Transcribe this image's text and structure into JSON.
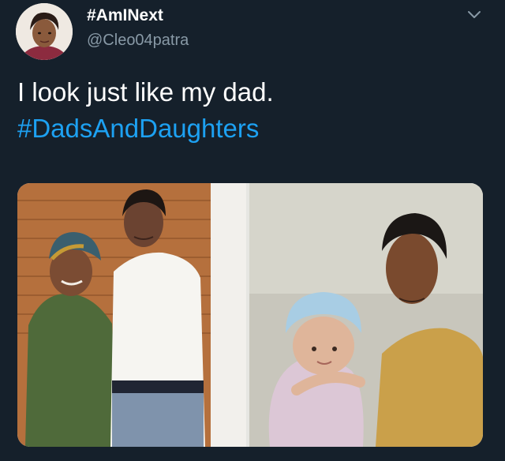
{
  "tweet": {
    "author": {
      "display_name": "#AmINext",
      "handle": "@Cleo04patra",
      "avatar_icon": "profile-photo"
    },
    "menu_icon": "chevron-down-icon",
    "text_line_1": "I look just like my dad.",
    "hashtag": "#DadsAndDaughters",
    "media": {
      "photo_count": 2
    }
  },
  "colors": {
    "background": "#15202b",
    "primary_text": "#ffffff",
    "secondary_text": "#8899a6",
    "link": "#1da1f2"
  }
}
